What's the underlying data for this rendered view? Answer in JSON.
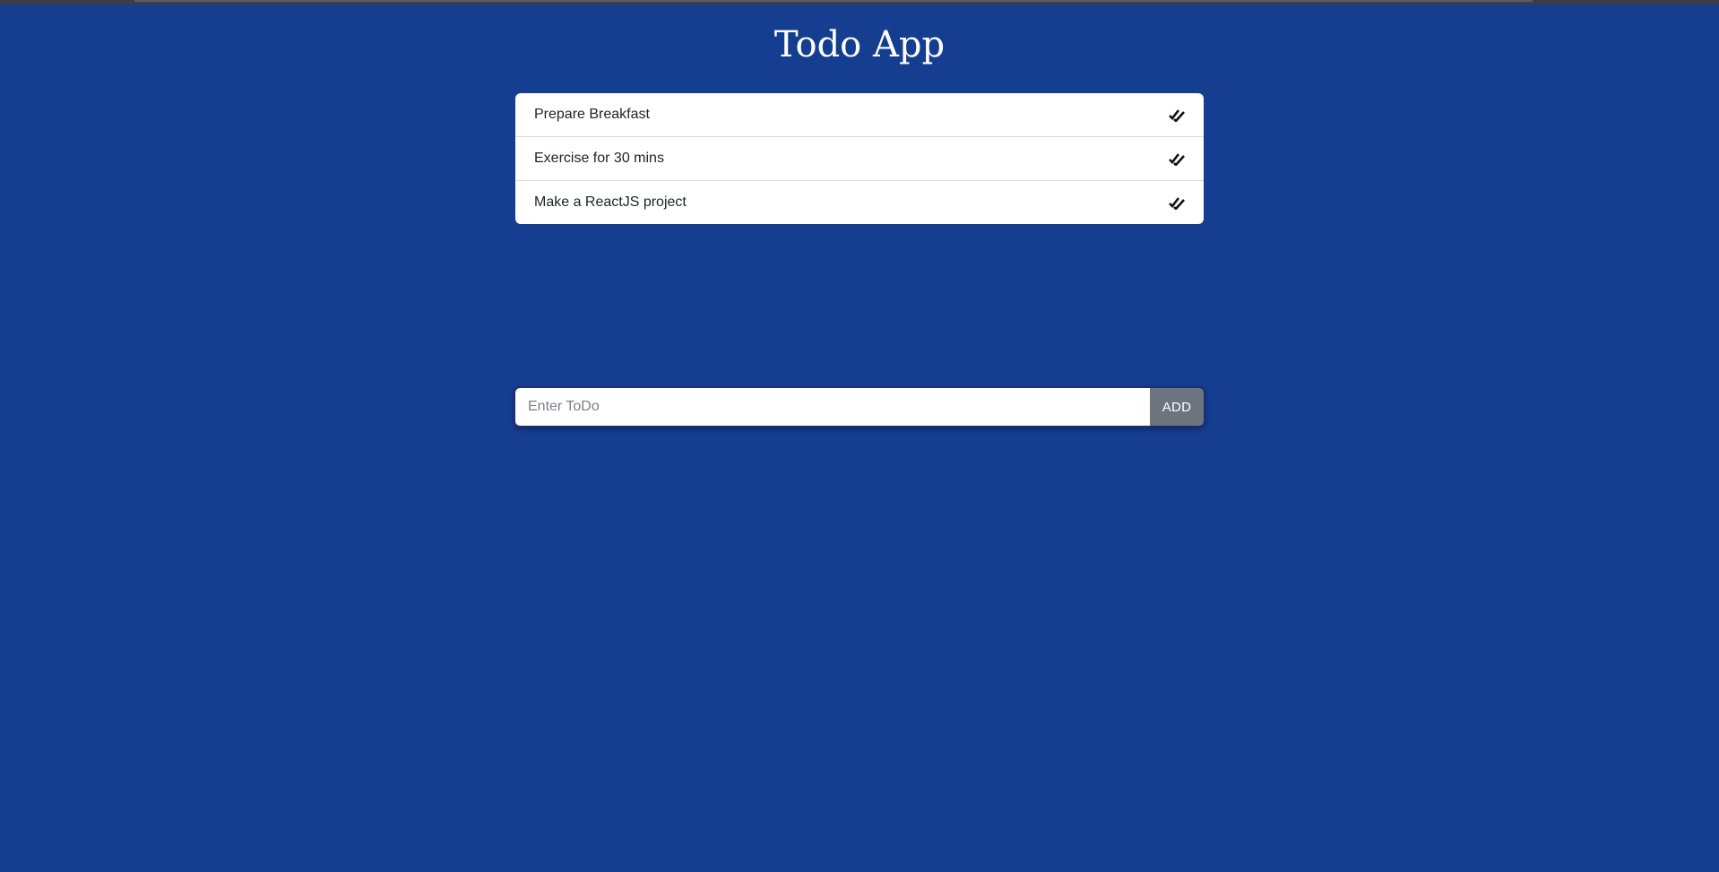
{
  "app": {
    "title": "Todo App"
  },
  "todos": [
    {
      "text": "Prepare Breakfast",
      "icon": "double-check-icon"
    },
    {
      "text": "Exercise for 30 mins",
      "icon": "double-check-icon"
    },
    {
      "text": "Make a ReactJS project",
      "icon": "double-check-icon"
    }
  ],
  "input": {
    "value": "",
    "placeholder": "Enter ToDo"
  },
  "add_button": {
    "label": "ADD"
  },
  "colors": {
    "background": "#153e90",
    "card": "#ffffff",
    "button": "#6c757d"
  }
}
